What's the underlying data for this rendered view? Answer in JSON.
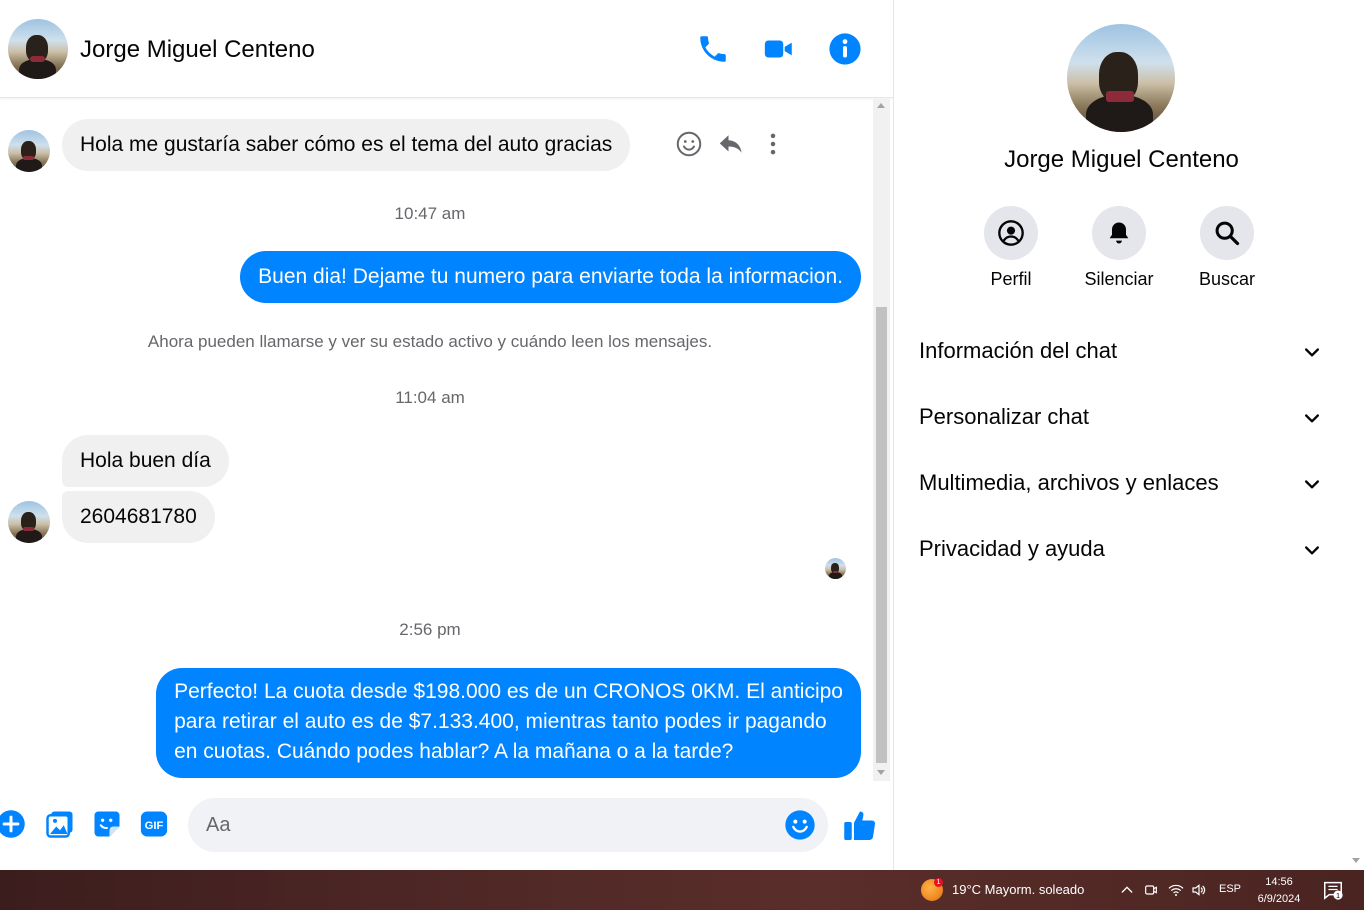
{
  "contact": {
    "name": "Jorge Miguel Centeno"
  },
  "header": {
    "icons": [
      "phone-call-icon",
      "video-call-icon",
      "info-icon"
    ]
  },
  "messages": [
    {
      "side": "incoming",
      "text": "Hola me gustaría saber cómo es el tema del auto gracias"
    },
    {
      "type": "timestamp",
      "text": "10:47 am"
    },
    {
      "side": "outgoing",
      "text": "Buen dia! Dejame tu numero para enviarte toda la informacion."
    },
    {
      "type": "system",
      "text": "Ahora pueden llamarse y ver su estado activo y cuándo leen los mensajes."
    },
    {
      "type": "timestamp",
      "text": "11:04 am"
    },
    {
      "side": "incoming",
      "text": "Hola buen día"
    },
    {
      "side": "incoming",
      "text": "2604681780"
    },
    {
      "type": "timestamp",
      "text": "2:56 pm"
    },
    {
      "side": "outgoing",
      "lines": [
        "Perfecto! La cuota desde $198.000 es de un CRONOS 0KM. El anticipo",
        "para retirar el auto es de $7.133.400, mientras tanto podes ir pagando",
        "en cuotas. Cuándo podes hablar? A la mañana o a la tarde?"
      ]
    }
  ],
  "message_actions": [
    "react-icon",
    "reply-icon",
    "more-icon"
  ],
  "composer": {
    "placeholder": "Aa",
    "icons": [
      "add-icon",
      "gallery-icon",
      "sticker-icon",
      "gif-icon",
      "emoji-icon",
      "like-icon"
    ]
  },
  "info_panel": {
    "name": "Jorge Miguel Centeno",
    "actions": [
      {
        "label": "Perfil",
        "icon": "profile-icon"
      },
      {
        "label": "Silenciar",
        "icon": "bell-icon"
      },
      {
        "label": "Buscar",
        "icon": "search-icon"
      }
    ],
    "sections": [
      {
        "label": "Información del chat"
      },
      {
        "label": "Personalizar chat"
      },
      {
        "label": "Multimedia, archivos y enlaces"
      },
      {
        "label": "Privacidad y ayuda"
      }
    ]
  },
  "taskbar": {
    "weather": "19°C  Mayorm. soleado",
    "weather_badge": "1",
    "language": "ESP",
    "time": "14:56",
    "date": "6/9/2024",
    "notification_count": "1"
  },
  "colors": {
    "accent": "#0084ff",
    "incoming_bubble": "#f0f0f0",
    "muted_text": "#65676b"
  }
}
